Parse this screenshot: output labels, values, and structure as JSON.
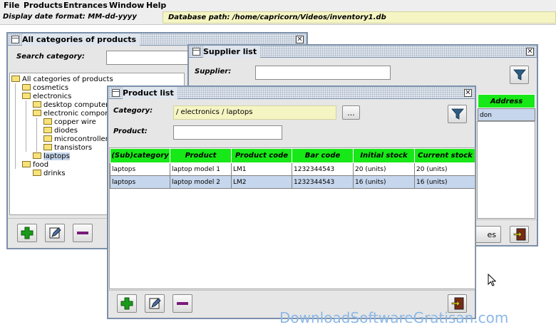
{
  "menubar": {
    "items": [
      "File",
      "Products",
      "Entrances",
      "Window",
      "Help"
    ]
  },
  "statusbar": {
    "date_format": "Display date format:  MM-dd-yyyy",
    "db_path": "Database path: /home/capricorn/Videos/inventory1.db"
  },
  "categories_window": {
    "title": "All categories of products",
    "search_label": "Search category:",
    "search_value": "",
    "tree": [
      "All categories of products",
      "cosmetics",
      "electronics",
      "desktop computers",
      "electronic compon",
      "copper wire",
      "diodes",
      "microcontrollers",
      "transistors",
      "laptops",
      "food",
      "drinks"
    ],
    "selected": "laptops"
  },
  "supplier_window": {
    "title": "Supplier list",
    "supplier_label": "Supplier:",
    "supplier_value": "",
    "visible_header": "Address",
    "visible_cell": "don",
    "partial_button": "es"
  },
  "product_window": {
    "title": "Product list",
    "category_label": "Category:",
    "category_value": "/ electronics / laptops",
    "browse_label": "...",
    "product_label": "Product:",
    "product_value": "",
    "columns": [
      "(Sub)category",
      "Product",
      "Product code",
      "Bar code",
      "Initial stock",
      "Current stock"
    ],
    "rows": [
      [
        "laptops",
        "laptop model 1",
        "LM1",
        "1232344543",
        "20 (units)",
        "20 (units)"
      ],
      [
        "laptops",
        "laptop model 2",
        "LM2",
        "1232344543",
        "16 (units)",
        "16 (units)"
      ]
    ]
  },
  "watermark": "DownloadSoftwareGratisan.com",
  "colors": {
    "header_green": "#17e817",
    "add_icon": "#1a9a1a",
    "remove_icon": "#7a1a7a",
    "selection": "#c6d6ec",
    "readonly_field": "#f5f5c4"
  },
  "icons": [
    "plus-icon",
    "edit-icon",
    "minus-icon",
    "filter-icon",
    "exit-icon"
  ]
}
